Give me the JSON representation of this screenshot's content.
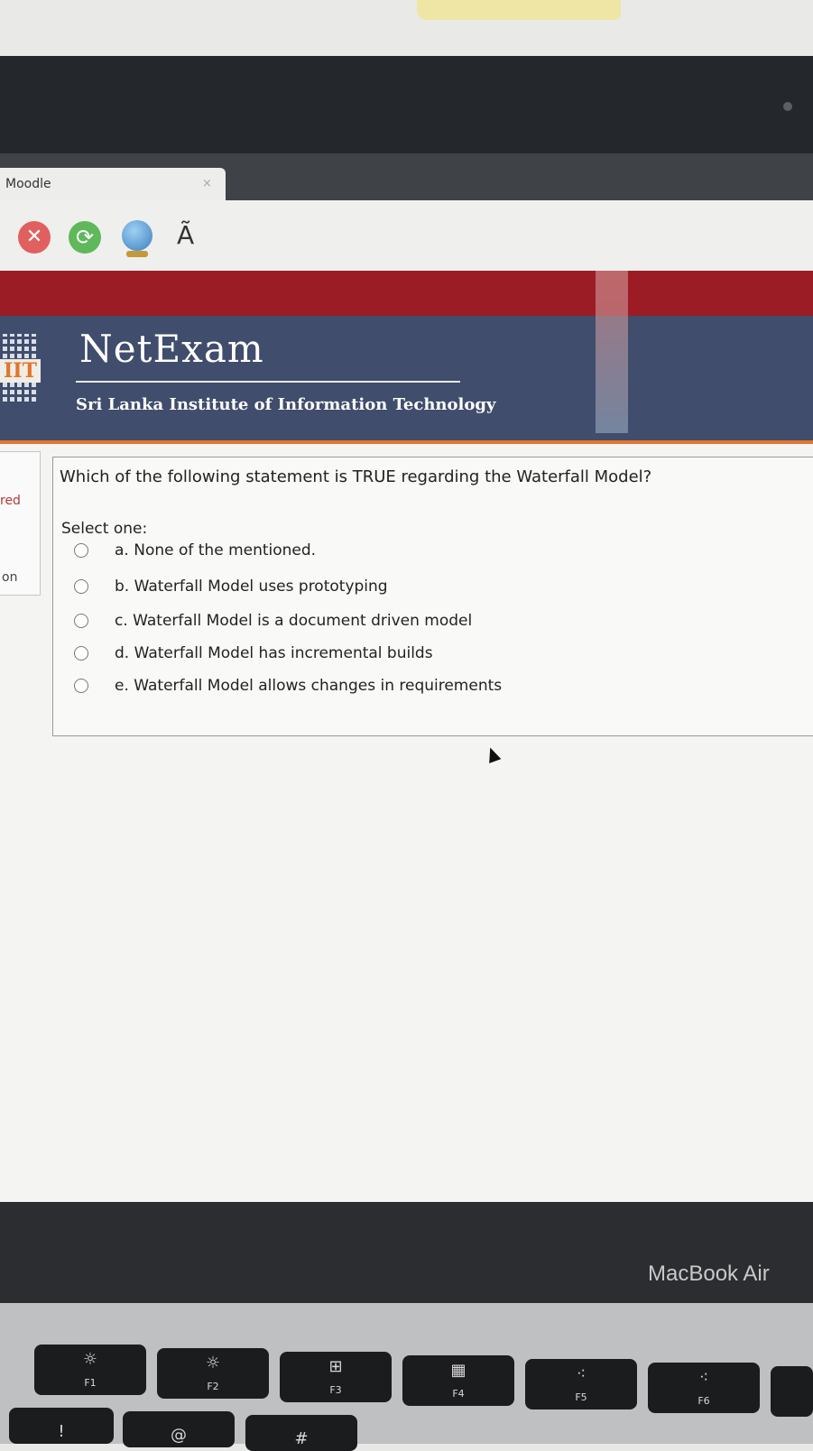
{
  "browser": {
    "tab_title": "Moodle",
    "tab_close": "×",
    "toolbar_char": "Ã"
  },
  "header": {
    "logo_text": "IIT",
    "brand": "NetExam",
    "institute": "Sri Lanka Institute of Information Technology"
  },
  "sidebar": {
    "label_red": "red",
    "label_on": "on"
  },
  "question": {
    "text": "Which of the following statement is TRUE regarding the Waterfall Model?",
    "select_label": "Select one:",
    "options": [
      {
        "label": "a. None of the mentioned."
      },
      {
        "label": "b. Waterfall Model uses prototyping"
      },
      {
        "label": "c. Waterfall Model is a document driven model"
      },
      {
        "label": "d. Waterfall Model has incremental builds"
      },
      {
        "label": "e. Waterfall Model allows changes in requirements"
      }
    ]
  },
  "device": {
    "label": "MacBook Air"
  },
  "keyboard": {
    "fn_keys": [
      {
        "symbol": "☼",
        "label": "F1"
      },
      {
        "symbol": "☼",
        "label": "F2"
      },
      {
        "symbol": "⊞",
        "label": "F3"
      },
      {
        "symbol": "▦",
        "label": "F4"
      },
      {
        "symbol": "⁖",
        "label": "F5"
      },
      {
        "symbol": "⁖",
        "label": "F6"
      }
    ],
    "row2": [
      "!",
      "@",
      "#"
    ]
  },
  "colors": {
    "header_bg": "#404d6c",
    "banner_red": "#9c1c25",
    "accent_orange": "#e0762c"
  }
}
